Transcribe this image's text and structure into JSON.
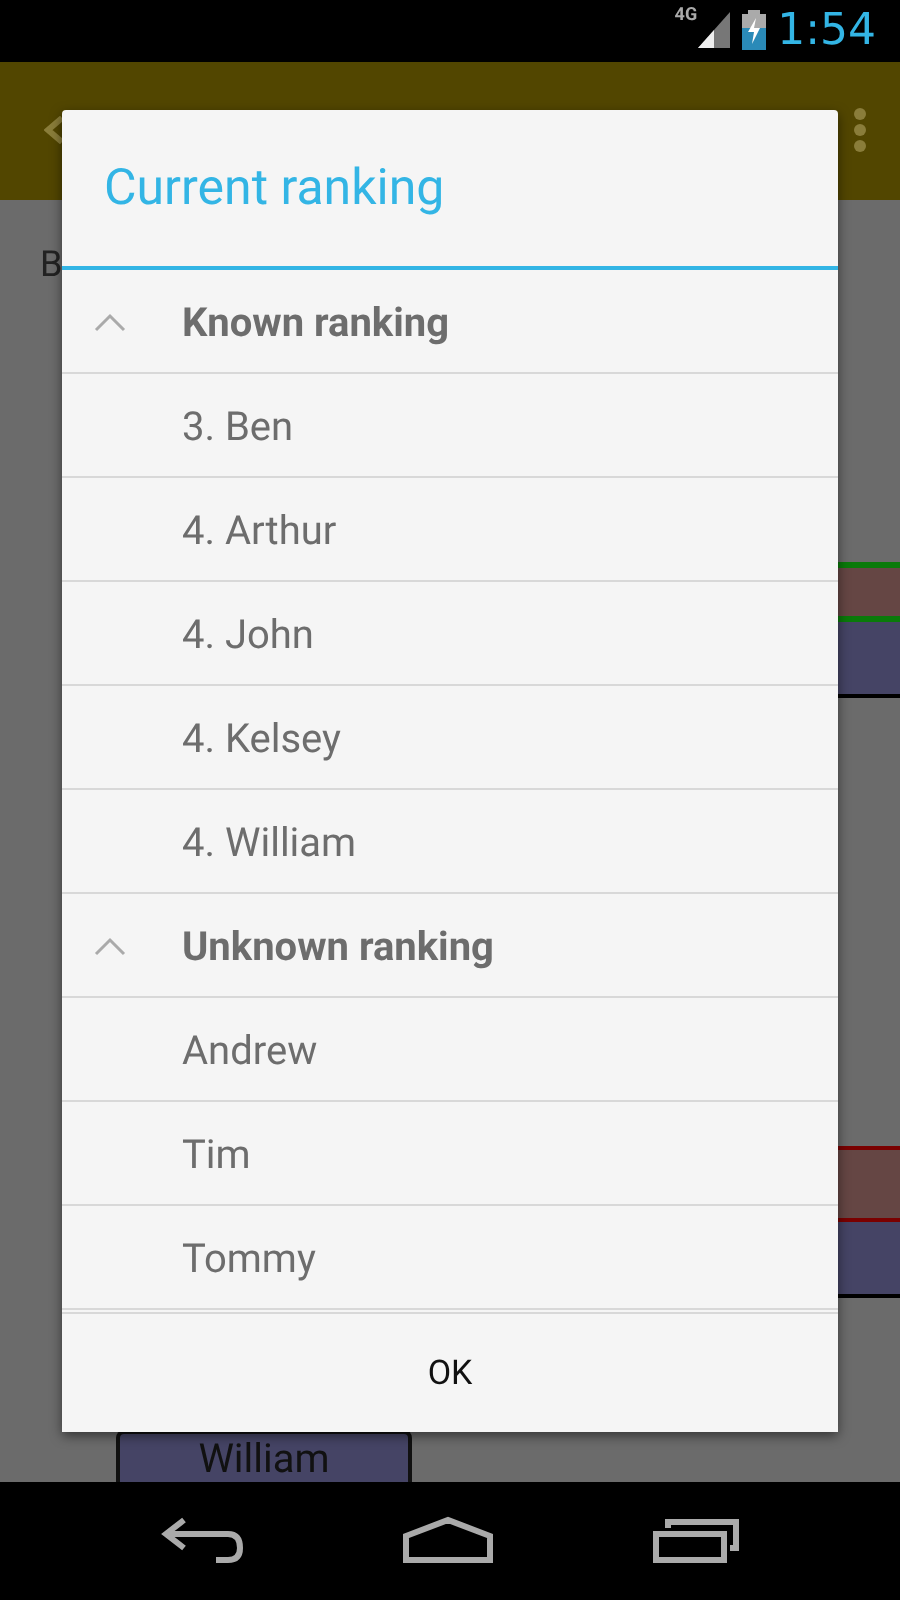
{
  "status_bar": {
    "network": "4G",
    "time": "1:54"
  },
  "background": {
    "label": "B",
    "name": "William"
  },
  "dialog": {
    "title": "Current ranking",
    "sections": [
      {
        "title": "Known ranking",
        "expanded": true,
        "items": [
          "3. Ben",
          "4. Arthur",
          "4. John",
          "4. Kelsey",
          "4. William"
        ]
      },
      {
        "title": "Unknown ranking",
        "expanded": true,
        "items": [
          "Andrew",
          "Tim",
          "Tommy"
        ]
      }
    ],
    "button": "OK"
  }
}
